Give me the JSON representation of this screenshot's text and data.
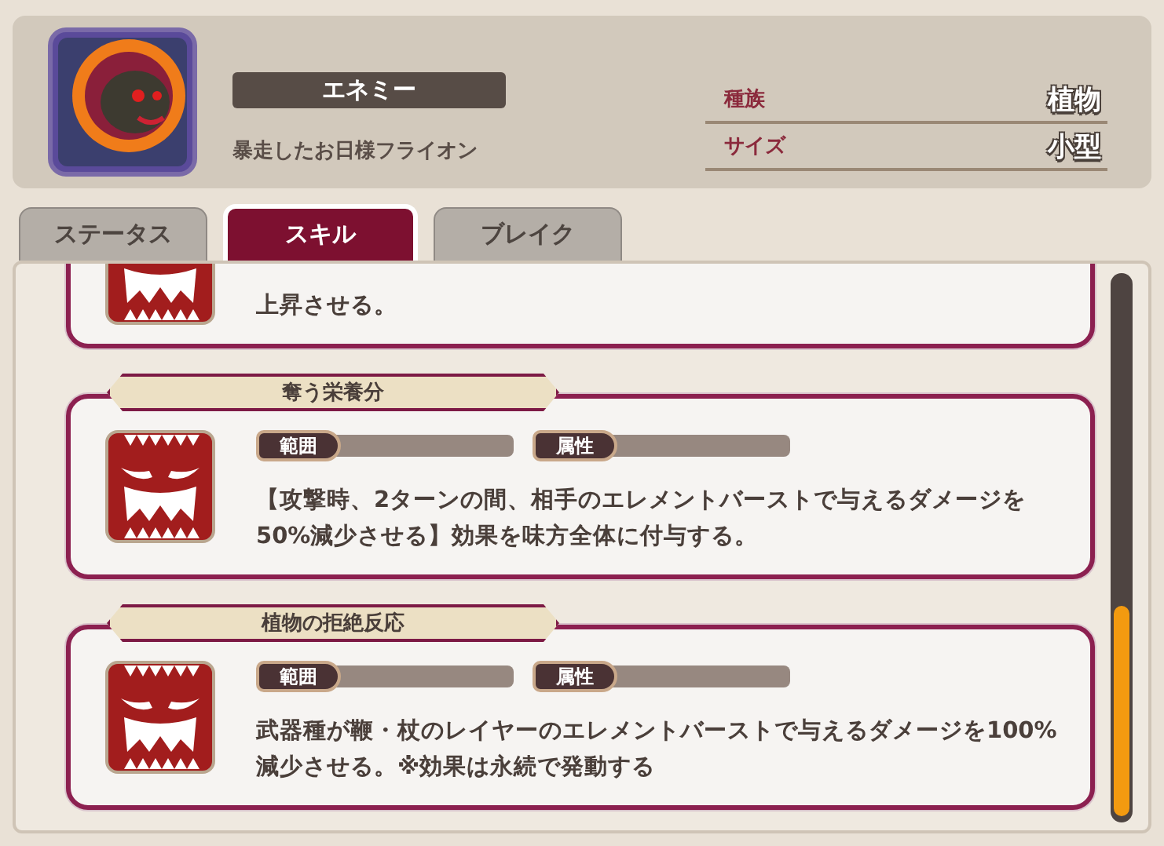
{
  "header": {
    "category": "エネミー",
    "name": "暴走したお日様フライオン",
    "attributes": [
      {
        "label": "種族",
        "value": "植物"
      },
      {
        "label": "サイズ",
        "value": "小型"
      }
    ]
  },
  "tabs": [
    {
      "label": "ステータス",
      "selected": false
    },
    {
      "label": "スキル",
      "selected": true
    },
    {
      "label": "ブレイク",
      "selected": false
    }
  ],
  "skills": [
    {
      "kind": "cut",
      "description": "上昇させる。"
    },
    {
      "kind": "full",
      "title": "奪う栄養分",
      "range_label": "範囲",
      "attribute_label": "属性",
      "description": "【攻撃時、2ターンの間、相手のエレメントバーストで与えるダメージを50%減少させる】効果を味方全体に付与する。"
    },
    {
      "kind": "full",
      "title": "植物の拒絶反応",
      "range_label": "範囲",
      "attribute_label": "属性",
      "description": "武器種が鞭・杖のレイヤーのエレメントバーストで与えるダメージを100%減少させる。※効果は永続で発動する"
    }
  ]
}
